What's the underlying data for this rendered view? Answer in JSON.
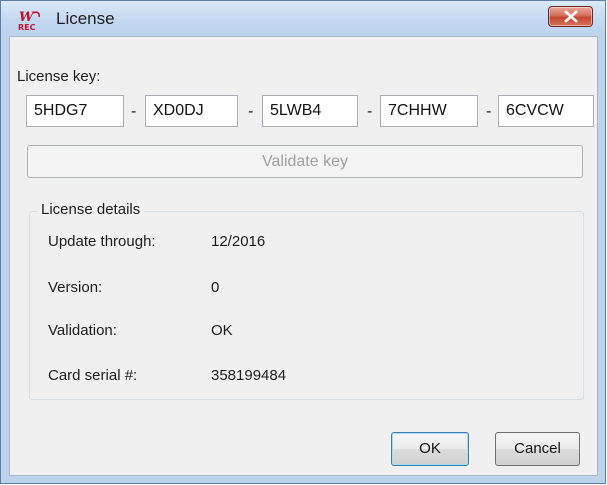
{
  "window": {
    "title": "License",
    "close_label": "Close"
  },
  "license_key": {
    "label": "License key:",
    "segments": [
      "5HDG7",
      "XD0DJ",
      "5LWB4",
      "7CHHW",
      "6CVCW"
    ],
    "separator": "-"
  },
  "validate_button": {
    "label": "Validate key",
    "enabled": false
  },
  "details": {
    "group_title": "License details",
    "rows": [
      {
        "label": "Update through:",
        "value": "12/2016"
      },
      {
        "label": "Version:",
        "value": "0"
      },
      {
        "label": "Validation:",
        "value": "OK"
      },
      {
        "label": "Card serial #:",
        "value": "358199484"
      }
    ]
  },
  "buttons": {
    "ok": "OK",
    "cancel": "Cancel"
  },
  "icons": {
    "app": "app-logo-icon",
    "close": "close-x-icon"
  },
  "colors": {
    "title_gradient_top": "#dbe9f9",
    "window_frame": "#bcd3ee",
    "close_button": "#c2462f",
    "logo_red": "#c8102e",
    "dialog_background": "#f0f0f0",
    "disabled_text": "#a0a0a0"
  }
}
